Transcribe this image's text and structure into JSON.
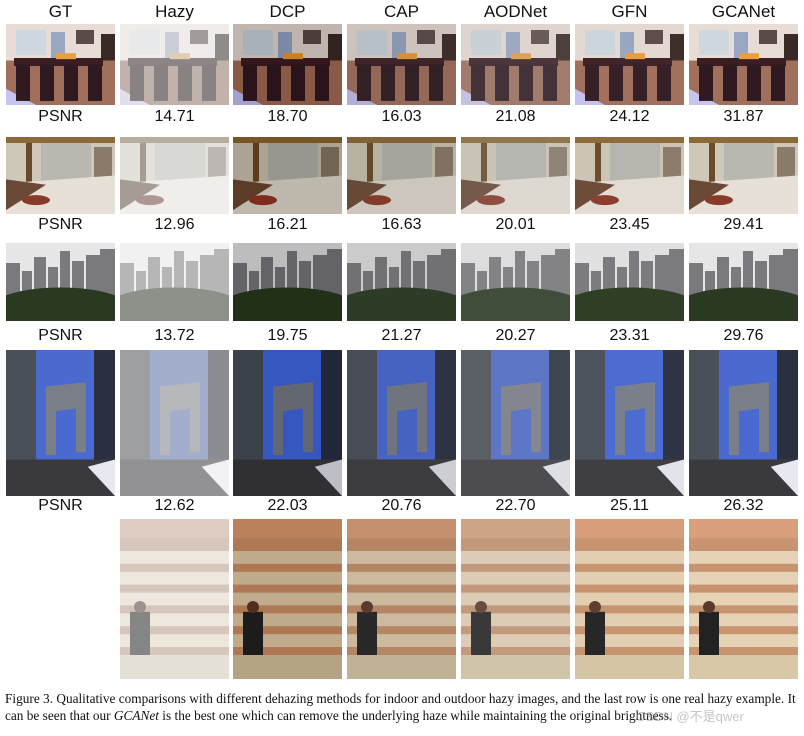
{
  "columns": [
    "GT",
    "Hazy",
    "DCP",
    "CAP",
    "AODNet",
    "GFN",
    "GCANet"
  ],
  "rows": [
    {
      "scene": "indoor dining room",
      "metric_label": "PSNR",
      "psnr": [
        "14.71",
        "18.70",
        "16.03",
        "21.08",
        "24.12",
        "31.87"
      ]
    },
    {
      "scene": "indoor room with glass doors",
      "metric_label": "PSNR",
      "psnr": [
        "12.96",
        "16.21",
        "16.63",
        "20.01",
        "23.45",
        "29.41"
      ]
    },
    {
      "scene": "city buildings with trees",
      "metric_label": "PSNR",
      "psnr": [
        "13.72",
        "19.75",
        "21.27",
        "20.27",
        "23.31",
        "29.76"
      ]
    },
    {
      "scene": "CCTV tower street",
      "metric_label": "PSNR",
      "psnr": [
        "12.62",
        "22.03",
        "20.76",
        "22.70",
        "25.11",
        "26.32"
      ]
    },
    {
      "scene": "real hazy Forbidden City",
      "metric_label": "",
      "psnr": []
    }
  ],
  "caption": {
    "part1": "Figure 3. Qualitative comparisons with different dehazing methods for indoor and outdoor hazy images, and the last row is one real hazy example. It can be seen that our ",
    "method": "GCANet",
    "part2": " is the best one which can remove the underlying haze while maintaining the original brightness."
  },
  "watermark": "CSDN @不是qwer"
}
